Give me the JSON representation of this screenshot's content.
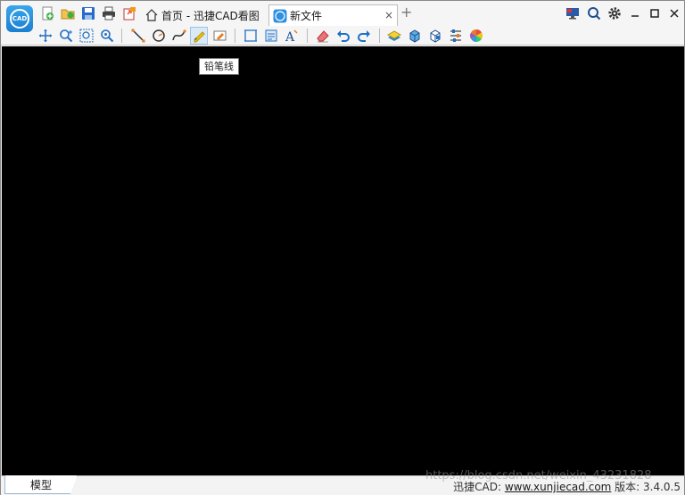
{
  "titlebar": {
    "logo_text": "CAD",
    "quick_access_icons": [
      "new-file-icon",
      "open-file-icon",
      "save-icon",
      "print-icon",
      "export-icon"
    ],
    "tabs": [
      {
        "label": "首页 - 迅捷CAD看图",
        "icon": "home-icon",
        "active": false
      },
      {
        "label": "新文件",
        "icon": "cad-file-icon",
        "active": true
      }
    ],
    "close_tab_glyph": "×",
    "new_tab_glyph": "+",
    "window_controls": [
      "monitor-icon",
      "search-icon",
      "gear-icon",
      "minimize-icon",
      "maximize-icon",
      "close-icon"
    ]
  },
  "toolbar": {
    "groups": [
      [
        "pan-icon",
        "zoom-icon",
        "zoom-window-icon",
        "zoom-extents-icon"
      ],
      [
        "line-icon",
        "circle-icon",
        "curve-icon",
        "pencil-line-icon",
        "erase-draw-icon"
      ],
      [
        "rect-measure-icon",
        "area-icon",
        "text-icon"
      ],
      [
        "eraser-icon",
        "undo-icon",
        "redo-icon"
      ],
      [
        "layer-icon",
        "3d-box-icon",
        "3d-view-icon",
        "properties-icon",
        "color-wheel-icon"
      ]
    ],
    "pressed_tool": "pencil-line-icon"
  },
  "tooltip": {
    "text": "铅笔线"
  },
  "statusbar": {
    "model_tab": "模型",
    "brand_prefix": "迅捷CAD: ",
    "website": "www.xunjiecad.com",
    "version_label": " 版本: 3.4.0.5"
  },
  "watermark": {
    "text": "https://blog.csdn.net/weixin_43231828"
  },
  "colors": {
    "canvas": "#000000",
    "accent": "#1b7fd0",
    "chrome": "#f5f5f5"
  }
}
